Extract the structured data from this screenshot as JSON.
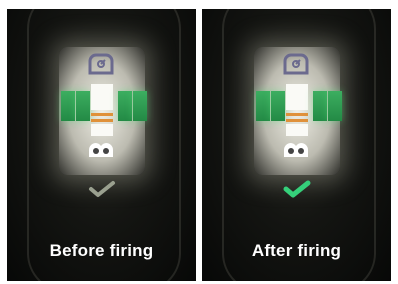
{
  "panels": [
    {
      "caption": "Before firing",
      "indicator": "dim-check-icon",
      "indicator_color": "#9aa08f"
    },
    {
      "caption": "After firing",
      "indicator": "green-check-icon",
      "indicator_color": "#35d07a"
    }
  ],
  "colors": {
    "green_segment": "#2fa055",
    "orange_stripe": "#e0913a",
    "background": "#0c0d0b"
  }
}
